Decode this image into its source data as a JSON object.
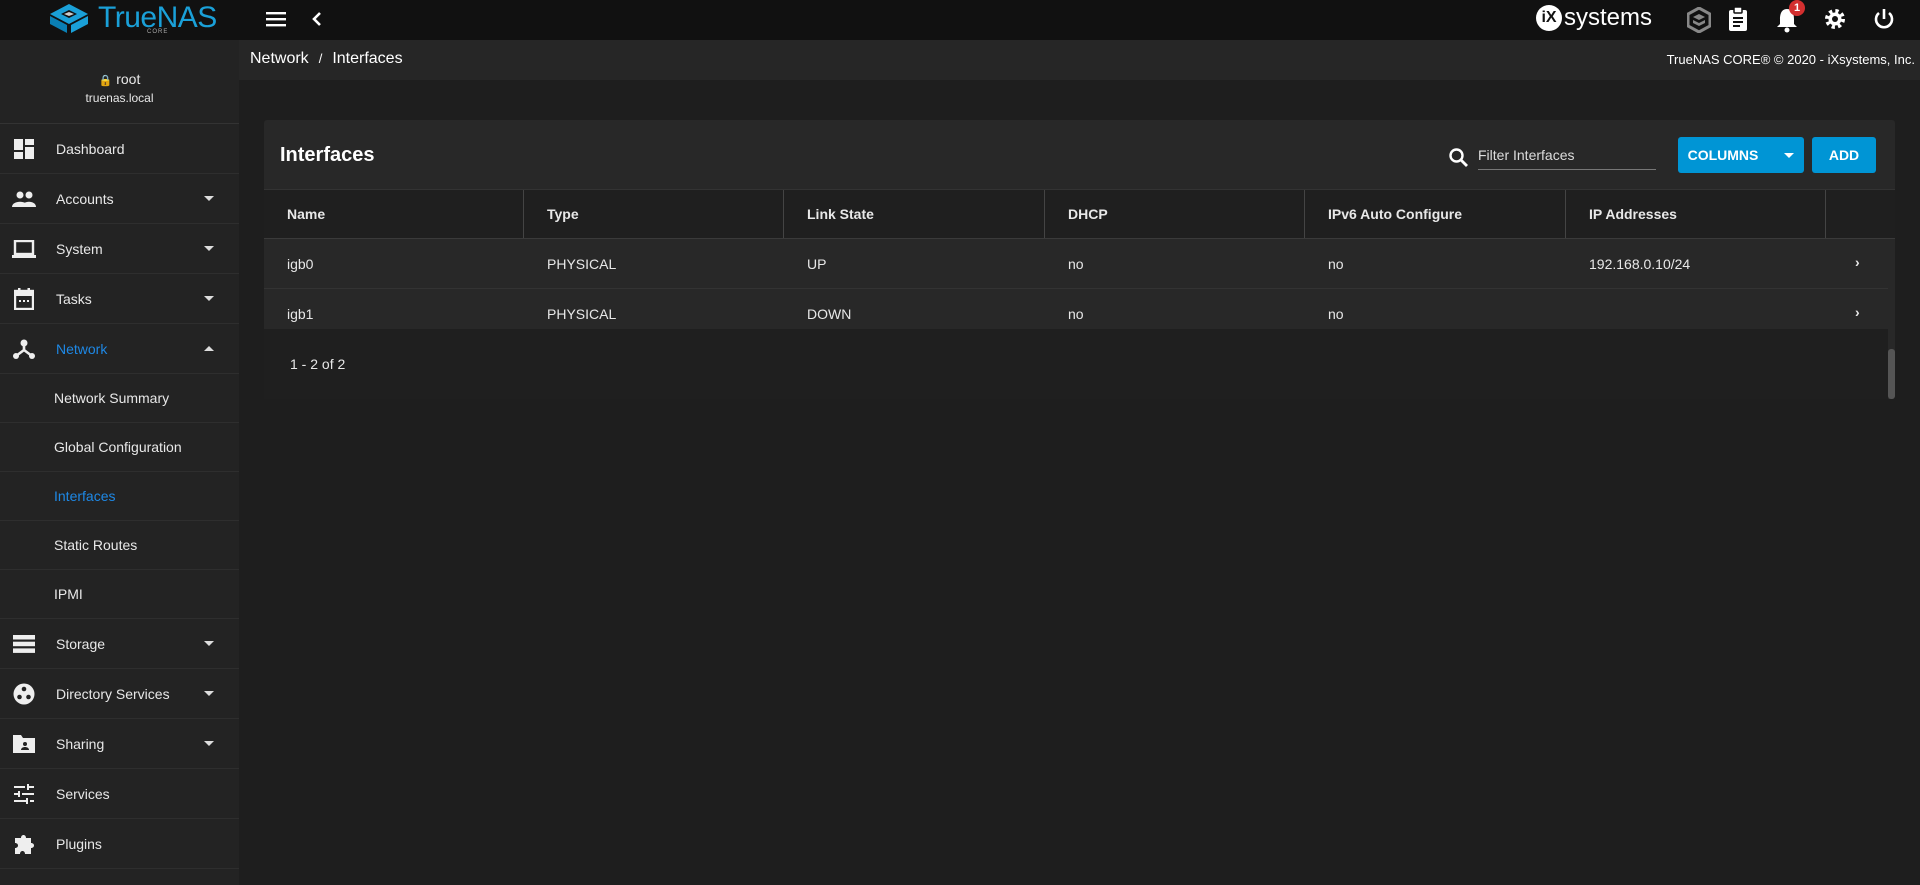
{
  "topbar": {
    "brand": "TrueNAS",
    "brand_sub": "CORE",
    "vendor": "systems",
    "vendor_mark": "iX",
    "notification_count": "1"
  },
  "user": {
    "name": "root",
    "host": "truenas.local"
  },
  "sidebar": {
    "items": [
      {
        "label": "Dashboard",
        "icon": "dashboard-icon",
        "expandable": false
      },
      {
        "label": "Accounts",
        "icon": "accounts-icon",
        "expandable": true
      },
      {
        "label": "System",
        "icon": "laptop-icon",
        "expandable": true
      },
      {
        "label": "Tasks",
        "icon": "calendar-icon",
        "expandable": true
      },
      {
        "label": "Network",
        "icon": "network-icon",
        "expandable": true,
        "expanded": true,
        "active": true
      },
      {
        "label": "Storage",
        "icon": "storage-icon",
        "expandable": true
      },
      {
        "label": "Directory Services",
        "icon": "directory-icon",
        "expandable": true
      },
      {
        "label": "Sharing",
        "icon": "folder-shared-icon",
        "expandable": true
      },
      {
        "label": "Services",
        "icon": "tune-icon",
        "expandable": false
      },
      {
        "label": "Plugins",
        "icon": "puzzle-icon",
        "expandable": false
      }
    ],
    "network_sub": [
      "Network Summary",
      "Global Configuration",
      "Interfaces",
      "Static Routes",
      "IPMI"
    ]
  },
  "breadcrumb": {
    "parent": "Network",
    "sep": "/",
    "current": "Interfaces"
  },
  "copyright": "TrueNAS CORE® © 2020 - iXsystems, Inc.",
  "card": {
    "title": "Interfaces",
    "filter_placeholder": "Filter Interfaces",
    "columns_label": "COLUMNS",
    "add_label": "ADD",
    "headers": [
      "Name",
      "Type",
      "Link State",
      "DHCP",
      "IPv6 Auto Configure",
      "IP Addresses"
    ],
    "rows": [
      [
        "igb0",
        "PHYSICAL",
        "UP",
        "no",
        "no",
        "192.168.0.10/24"
      ],
      [
        "igb1",
        "PHYSICAL",
        "DOWN",
        "no",
        "no",
        ""
      ]
    ],
    "pagination": "1 - 2 of 2"
  },
  "colors": {
    "accent": "#0095d5",
    "active": "#1e88e5",
    "badge": "#d32f2f"
  }
}
